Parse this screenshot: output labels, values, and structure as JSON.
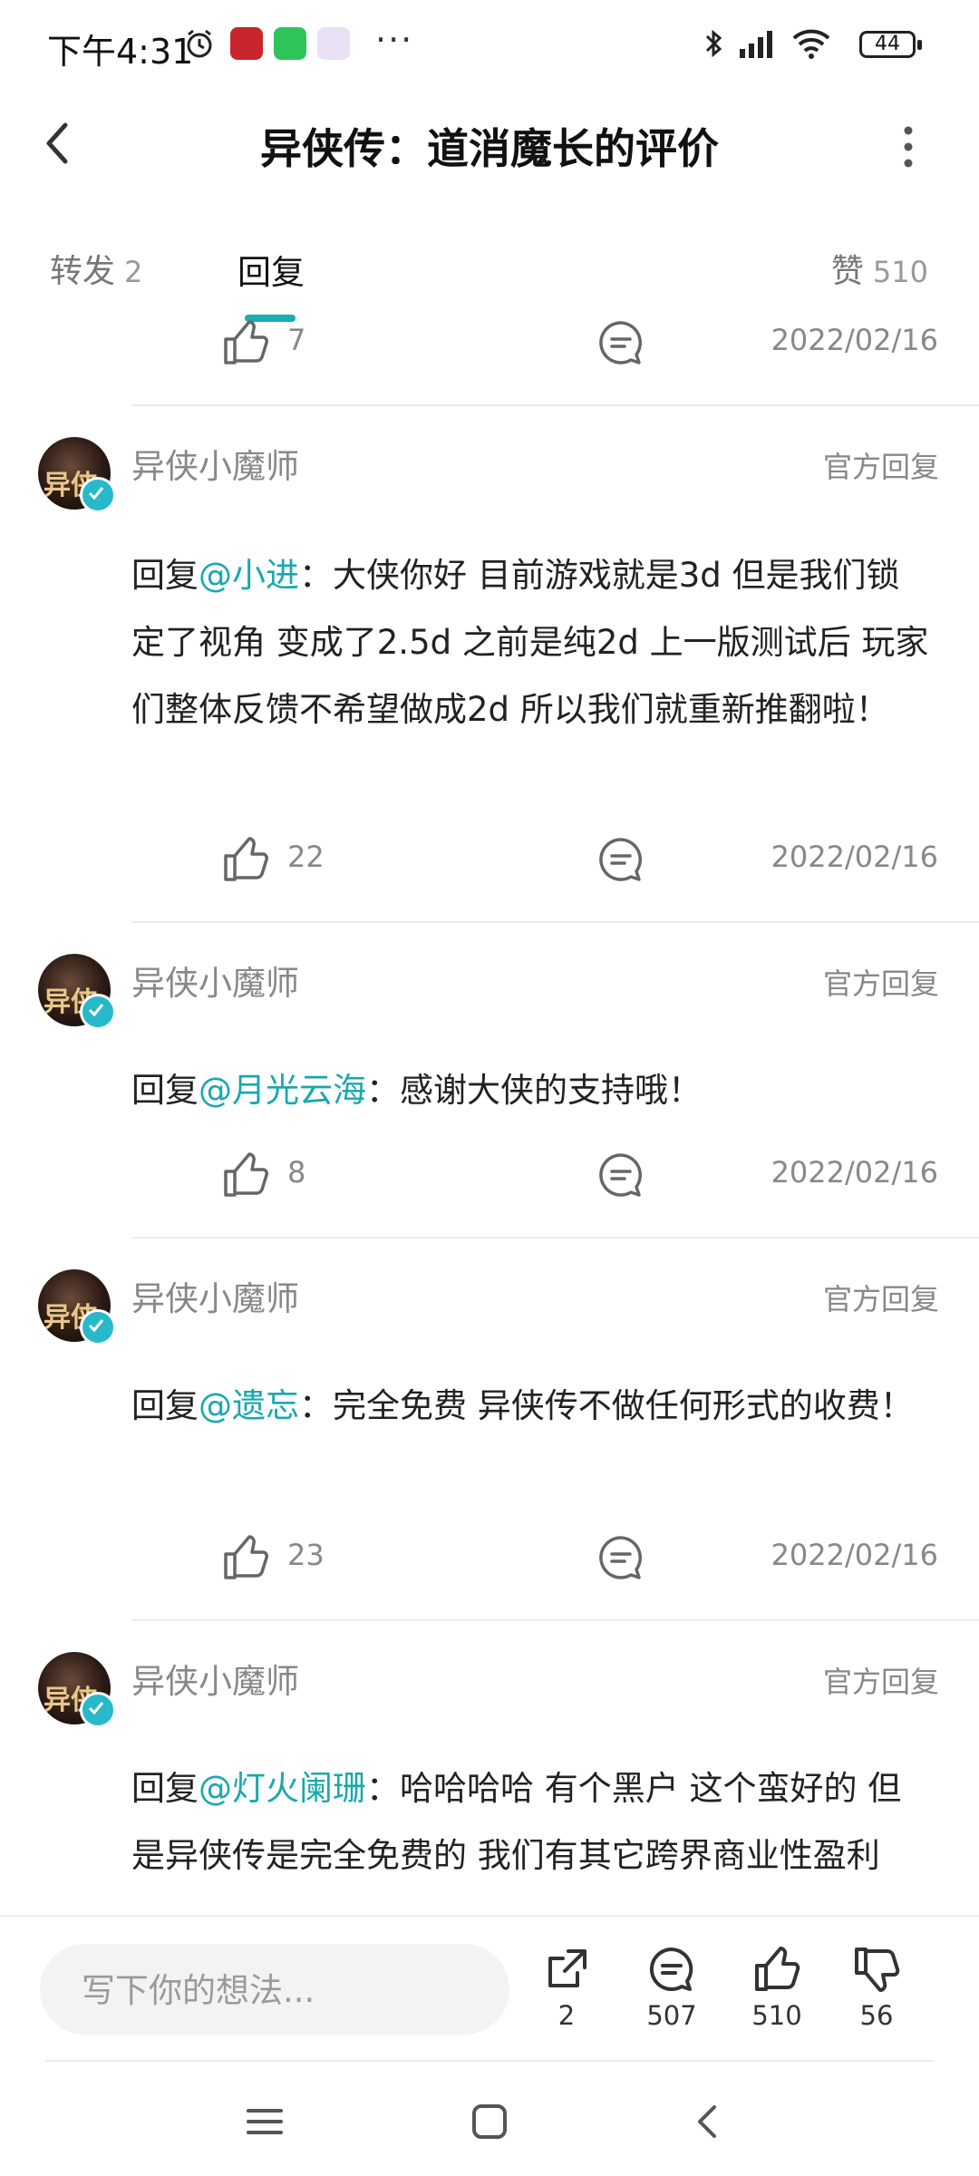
{
  "status_bar": {
    "time": "下午4:31",
    "more": "···",
    "battery": "44",
    "icons": [
      "alarm-icon",
      "app-icon-red",
      "wechat-icon",
      "app-icon-tieba",
      "bluetooth-icon",
      "signal-icon",
      "wifi-icon",
      "battery-icon"
    ]
  },
  "header": {
    "title": "异侠传：道消魔长的评价"
  },
  "tabs": {
    "forward_label": "转发",
    "forward_count": "2",
    "reply_label": "回复",
    "like_label": "赞",
    "like_count": "510"
  },
  "top_action": {
    "likes": "7",
    "date": "2022/02/16"
  },
  "comments": [
    {
      "username": "异侠小魔师",
      "official": "官方回复",
      "prefix": "回复",
      "mention": "@小进",
      "text": "：大侠你好 目前游戏就是3d 但是我们锁定了视角 变成了2.5d 之前是纯2d 上一版测试后 玩家们整体反馈不希望做成2d 所以我们就重新推翻啦！",
      "likes": "22",
      "date": "2022/02/16"
    },
    {
      "username": "异侠小魔师",
      "official": "官方回复",
      "prefix": "回复",
      "mention": "@月光云海",
      "text": "：感谢大侠的支持哦！",
      "likes": "8",
      "date": "2022/02/16"
    },
    {
      "username": "异侠小魔师",
      "official": "官方回复",
      "prefix": "回复",
      "mention": "@遗忘",
      "text": "：完全免费 异侠传不做任何形式的收费！",
      "likes": "23",
      "date": "2022/02/16"
    },
    {
      "username": "异侠小魔师",
      "official": "官方回复",
      "prefix": "回复",
      "mention": "@灯火阑珊",
      "text": "：哈哈哈哈 有个黑户 这个蛮好的 但是异侠传是完全免费的 我们有其它跨界商业性盈利",
      "likes": "",
      "date": ""
    }
  ],
  "avatar_text": "异侠",
  "bottom_bar": {
    "placeholder": "写下你的想法...",
    "share_count": "2",
    "comment_count": "507",
    "like_count": "510",
    "dislike_count": "56"
  },
  "colors": {
    "accent": "#16b0b3",
    "mention": "#1aa8ad",
    "muted": "#888888"
  }
}
